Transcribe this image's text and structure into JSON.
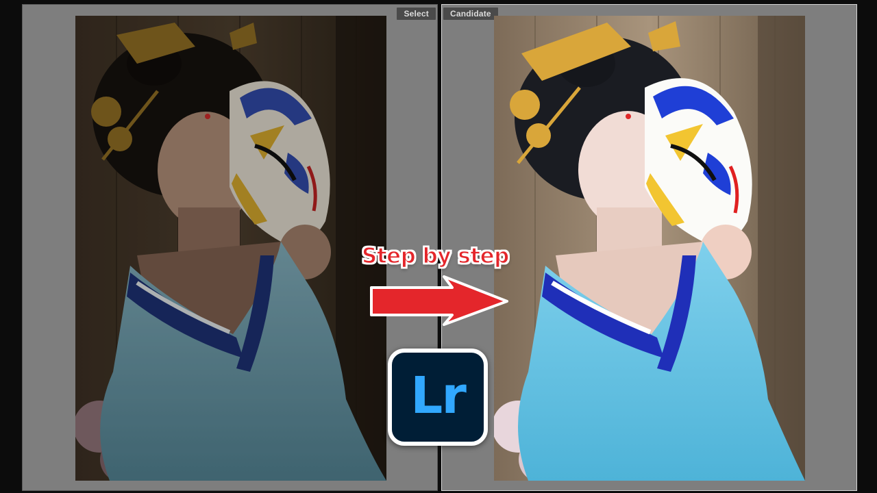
{
  "compare_view": {
    "select_label": "Select",
    "candidate_label": "Candidate"
  },
  "overlay": {
    "caption": "Step by step",
    "logo_text": "Lr",
    "arrow_icon": "arrow-right-icon",
    "caption_color": "#e4262b",
    "logo_bg": "#001e36",
    "logo_fg": "#31a8ff"
  },
  "photos": {
    "select": "before-edit-dark",
    "candidate": "after-edit-bright"
  }
}
